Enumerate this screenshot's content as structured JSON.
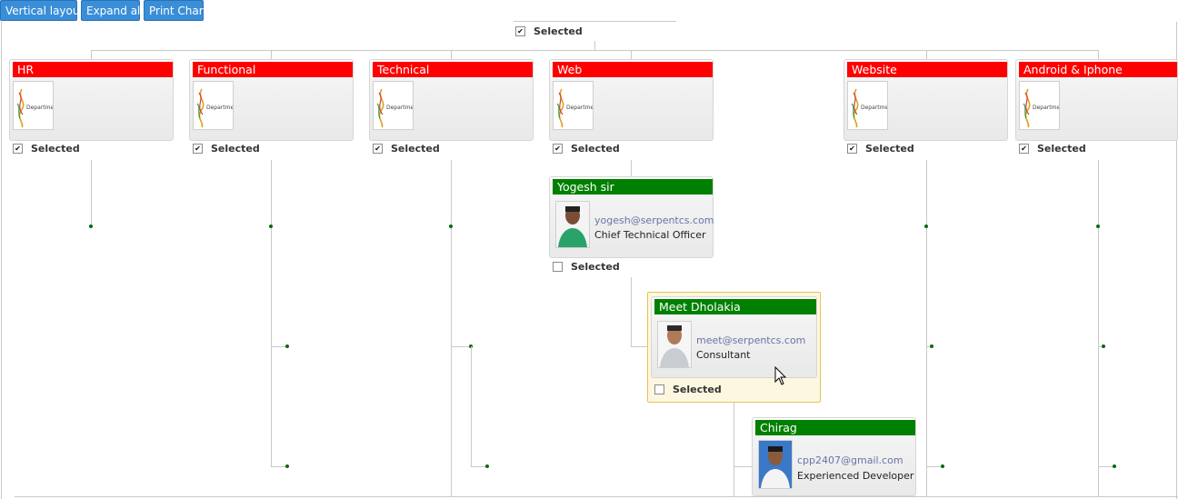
{
  "toolbar": {
    "vertical_layout": "Vertical layout",
    "expand_all": "Expand all",
    "print_chart": "Print Chart"
  },
  "root": {
    "selected_label": "Selected",
    "checked": true
  },
  "departments": [
    {
      "name": "HR",
      "selected_label": "Selected",
      "checked": true
    },
    {
      "name": "Functional",
      "selected_label": "Selected",
      "checked": true
    },
    {
      "name": "Technical",
      "selected_label": "Selected",
      "checked": true
    },
    {
      "name": "Web",
      "selected_label": "Selected",
      "checked": true
    },
    {
      "name": "Website",
      "selected_label": "Selected",
      "checked": true
    },
    {
      "name": "Android & Iphone",
      "selected_label": "Selected",
      "checked": true
    }
  ],
  "employees": [
    {
      "name": "Yogesh sir",
      "email": "yogesh@serpentcs.com",
      "job": "Chief Technical Officer",
      "selected_label": "Selected",
      "checked": false
    },
    {
      "name": "Meet Dholakia",
      "email": "meet@serpentcs.com",
      "job": "Consultant",
      "selected_label": "Selected",
      "checked": false
    },
    {
      "name": "Chirag",
      "email": "cpp2407@gmail.com",
      "job": "Experienced Developer"
    }
  ],
  "icons": {
    "department_logo": "department-logo-icon",
    "checkbox_checked": "checkbox-checked",
    "cursor": "mouse-cursor-icon"
  },
  "colors": {
    "department_header": "#ff0000",
    "employee_header": "#008000",
    "toolbar_button": "#3a8ed8",
    "highlight_border": "#e6c453",
    "connector_dot": "#0a6a0a"
  }
}
